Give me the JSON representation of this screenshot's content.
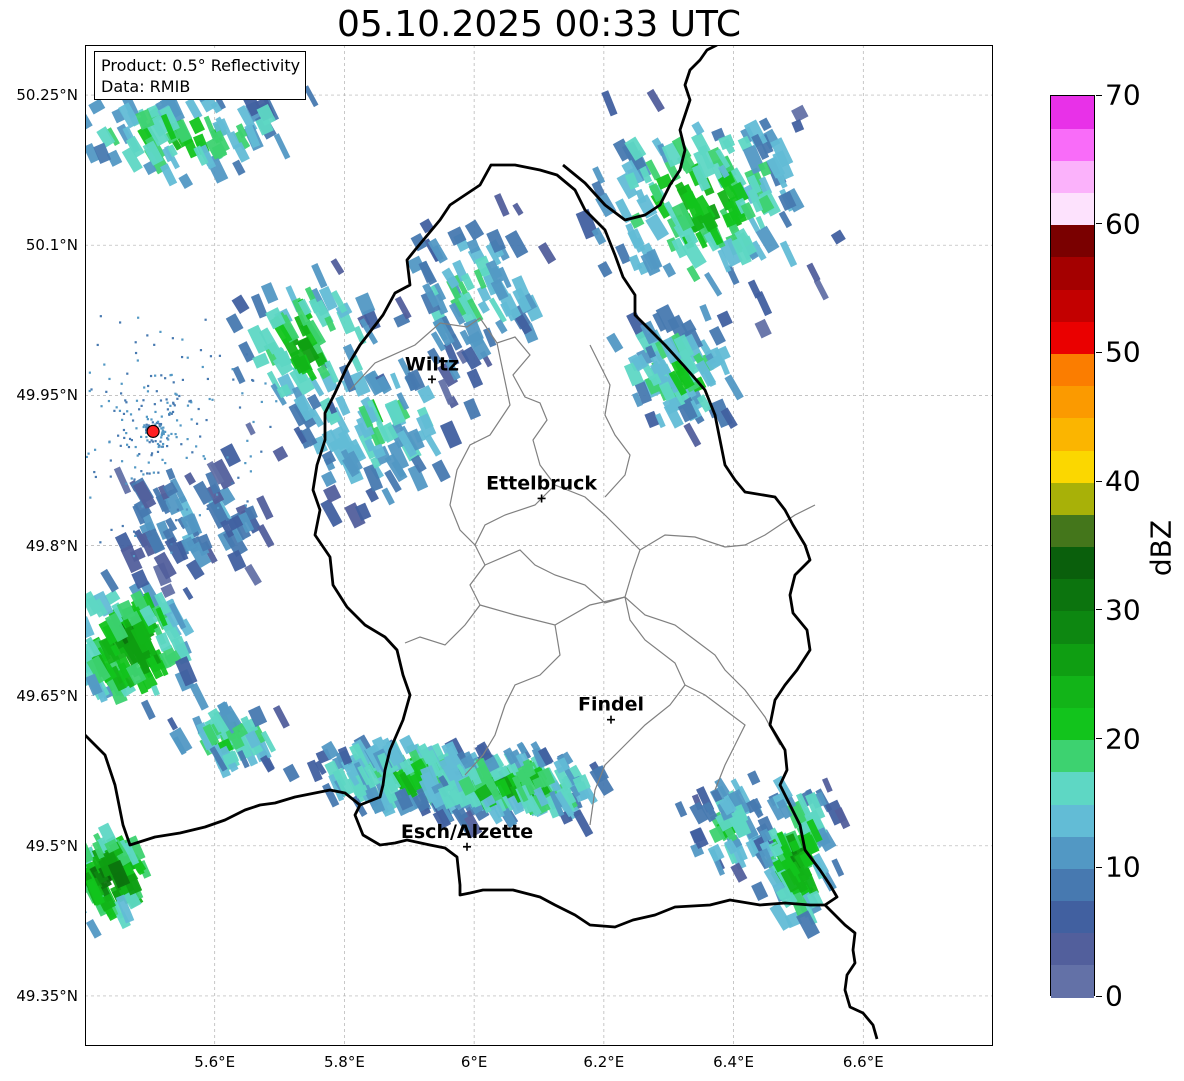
{
  "title": "05.10.2025 00:33 UTC",
  "info": {
    "product": "Product: 0.5° Reflectivity",
    "source": "Data: RMIB"
  },
  "map": {
    "lon_range": [
      5.4,
      6.8
    ],
    "lat_range": [
      49.3,
      50.3
    ],
    "lat_ticks": [
      {
        "value": 50.25,
        "label": "50.25°N"
      },
      {
        "value": 50.1,
        "label": "50.1°N"
      },
      {
        "value": 49.95,
        "label": "49.95°N"
      },
      {
        "value": 49.8,
        "label": "49.8°N"
      },
      {
        "value": 49.65,
        "label": "49.65°N"
      },
      {
        "value": 49.5,
        "label": "49.5°N"
      },
      {
        "value": 49.35,
        "label": "49.35°N"
      }
    ],
    "lon_ticks": [
      {
        "value": 5.6,
        "label": "5.6°E"
      },
      {
        "value": 5.8,
        "label": "5.8°E"
      },
      {
        "value": 6.0,
        "label": "6°E"
      },
      {
        "value": 6.2,
        "label": "6.2°E"
      },
      {
        "value": 6.4,
        "label": "6.4°E"
      },
      {
        "value": 6.6,
        "label": "6.6°E"
      }
    ],
    "gridlines": true,
    "radar_site": {
      "lon": 5.505,
      "lat": 49.914,
      "color": "#ff2020"
    },
    "cities": [
      {
        "name": "Wiltz",
        "lon": 5.935,
        "lat": 49.966
      },
      {
        "name": "Ettelbruck",
        "lon": 6.104,
        "lat": 49.847
      },
      {
        "name": "Findel",
        "lon": 6.211,
        "lat": 49.626
      },
      {
        "name": "Esch/Alzette",
        "lon": 5.989,
        "lat": 49.499
      }
    ],
    "border_color": "#000000",
    "canton_color": "#808080"
  },
  "colorbar": {
    "label": "dBZ",
    "min": 0,
    "max": 70,
    "ticks": [
      {
        "value": 0,
        "label": "0"
      },
      {
        "value": 10,
        "label": "10"
      },
      {
        "value": 20,
        "label": "20"
      },
      {
        "value": 30,
        "label": "30"
      },
      {
        "value": 40,
        "label": "40"
      },
      {
        "value": 50,
        "label": "50"
      },
      {
        "value": 60,
        "label": "60"
      },
      {
        "value": 70,
        "label": "70"
      }
    ],
    "colors": [
      "#6371a7",
      "#525f9c",
      "#4160a0",
      "#4779b0",
      "#5298c4",
      "#62bcd6",
      "#5ed7c4",
      "#3dd270",
      "#12c41c",
      "#12b418",
      "#0f9e12",
      "#0d8711",
      "#0c740e",
      "#0a5f0c",
      "#44761b",
      "#a8b108",
      "#fbd700",
      "#fbb500",
      "#fb9a00",
      "#fb7d00",
      "#ea0000",
      "#c30000",
      "#a40000",
      "#7a0000",
      "#fde2fd",
      "#fbb2fb",
      "#f96cf9",
      "#e831e8"
    ]
  },
  "echo_regions": [
    {
      "center": [
        5.47,
        49.7
      ],
      "spread": [
        0.07,
        0.05
      ],
      "count": 140,
      "peak": 31
    },
    {
      "center": [
        5.44,
        49.47
      ],
      "spread": [
        0.05,
        0.04
      ],
      "count": 90,
      "peak": 33
    },
    {
      "center": [
        5.57,
        49.82
      ],
      "spread": [
        0.1,
        0.05
      ],
      "count": 70,
      "peak": 12
    },
    {
      "center": [
        5.62,
        49.61
      ],
      "spread": [
        0.07,
        0.03
      ],
      "count": 60,
      "peak": 22
    },
    {
      "center": [
        5.9,
        49.57
      ],
      "spread": [
        0.13,
        0.03
      ],
      "count": 170,
      "peak": 22
    },
    {
      "center": [
        6.06,
        49.56
      ],
      "spread": [
        0.12,
        0.03
      ],
      "count": 170,
      "peak": 24
    },
    {
      "center": [
        6.4,
        49.52
      ],
      "spread": [
        0.06,
        0.04
      ],
      "count": 60,
      "peak": 18
    },
    {
      "center": [
        6.5,
        49.49
      ],
      "spread": [
        0.05,
        0.06
      ],
      "count": 110,
      "peak": 26
    },
    {
      "center": [
        6.35,
        50.14
      ],
      "spread": [
        0.14,
        0.08
      ],
      "count": 160,
      "peak": 24
    },
    {
      "center": [
        6.32,
        49.97
      ],
      "spread": [
        0.1,
        0.05
      ],
      "count": 90,
      "peak": 20
    },
    {
      "center": [
        5.55,
        50.21
      ],
      "spread": [
        0.16,
        0.04
      ],
      "count": 90,
      "peak": 22
    },
    {
      "center": [
        5.85,
        49.92
      ],
      "spread": [
        0.12,
        0.07
      ],
      "count": 90,
      "peak": 18
    },
    {
      "center": [
        6.0,
        50.05
      ],
      "spread": [
        0.1,
        0.07
      ],
      "count": 80,
      "peak": 18
    },
    {
      "center": [
        5.74,
        50.0
      ],
      "spread": [
        0.1,
        0.06
      ],
      "count": 70,
      "peak": 24
    }
  ]
}
